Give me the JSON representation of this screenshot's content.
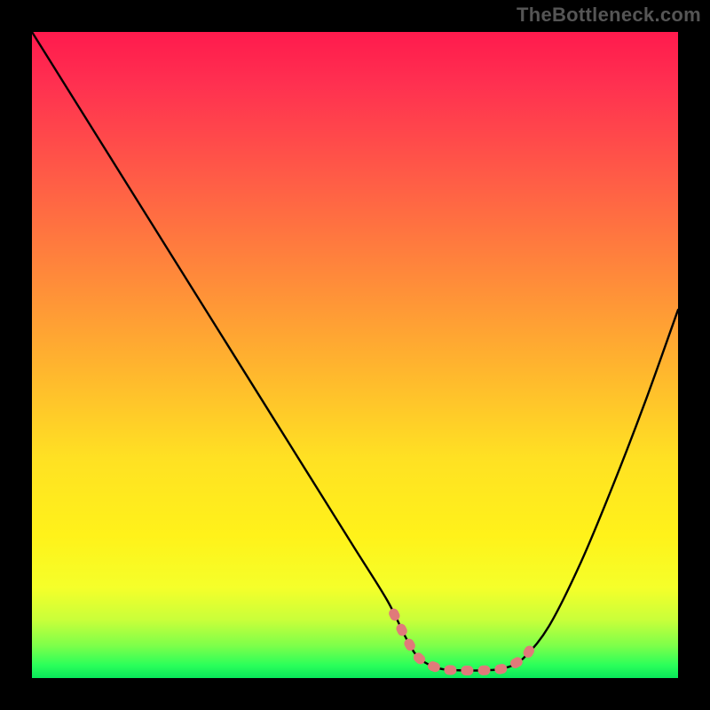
{
  "watermark": "TheBottleneck.com",
  "colors": {
    "background": "#000000",
    "curve_stroke": "#000000",
    "highlight_stroke": "#e07a7a",
    "gradient_top": "#ff1a4d",
    "gradient_bottom": "#08e85a"
  },
  "chart_data": {
    "type": "line",
    "title": "",
    "xlabel": "",
    "ylabel": "",
    "xlim": [
      0,
      100
    ],
    "ylim": [
      0,
      100
    ],
    "grid": false,
    "legend": false,
    "series": [
      {
        "name": "bottleneck-curve",
        "x": [
          0,
          5,
          10,
          15,
          20,
          25,
          30,
          35,
          40,
          45,
          50,
          55,
          58,
          60,
          63,
          66,
          70,
          73,
          76,
          80,
          85,
          90,
          95,
          100
        ],
        "y": [
          100,
          92,
          84,
          76,
          68,
          60,
          52,
          44,
          36,
          28,
          20,
          12,
          6,
          3,
          1.5,
          1.2,
          1.2,
          1.5,
          3,
          8,
          18,
          30,
          43,
          57
        ]
      }
    ],
    "highlight_segment": {
      "description": "flat minimum region near bottom of curve, drawn with dashed pink stroke",
      "x_start": 56,
      "x_end": 77
    }
  }
}
